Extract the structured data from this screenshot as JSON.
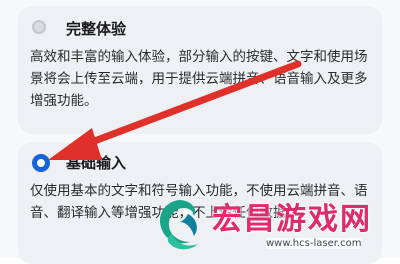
{
  "options": {
    "full": {
      "title": "完整体验",
      "description": "高效和丰富的输入体验，部分输入的按键、文字和使用场景将会上传至云端，用于提供云端拼音、语音输入及更多增强功能。",
      "selected": false
    },
    "basic": {
      "title": "基础输入",
      "description": "仅使用基本的文字和符号输入功能，不使用云端拼音、语音、翻译输入等增强功能，不上传任何数据。",
      "selected": true
    }
  },
  "annotation": {
    "arrow_color": "#e0302a"
  },
  "watermark": {
    "title": "宏昌游戏网",
    "url": "www.hcs-laser.com",
    "color": "#e02a6b"
  }
}
